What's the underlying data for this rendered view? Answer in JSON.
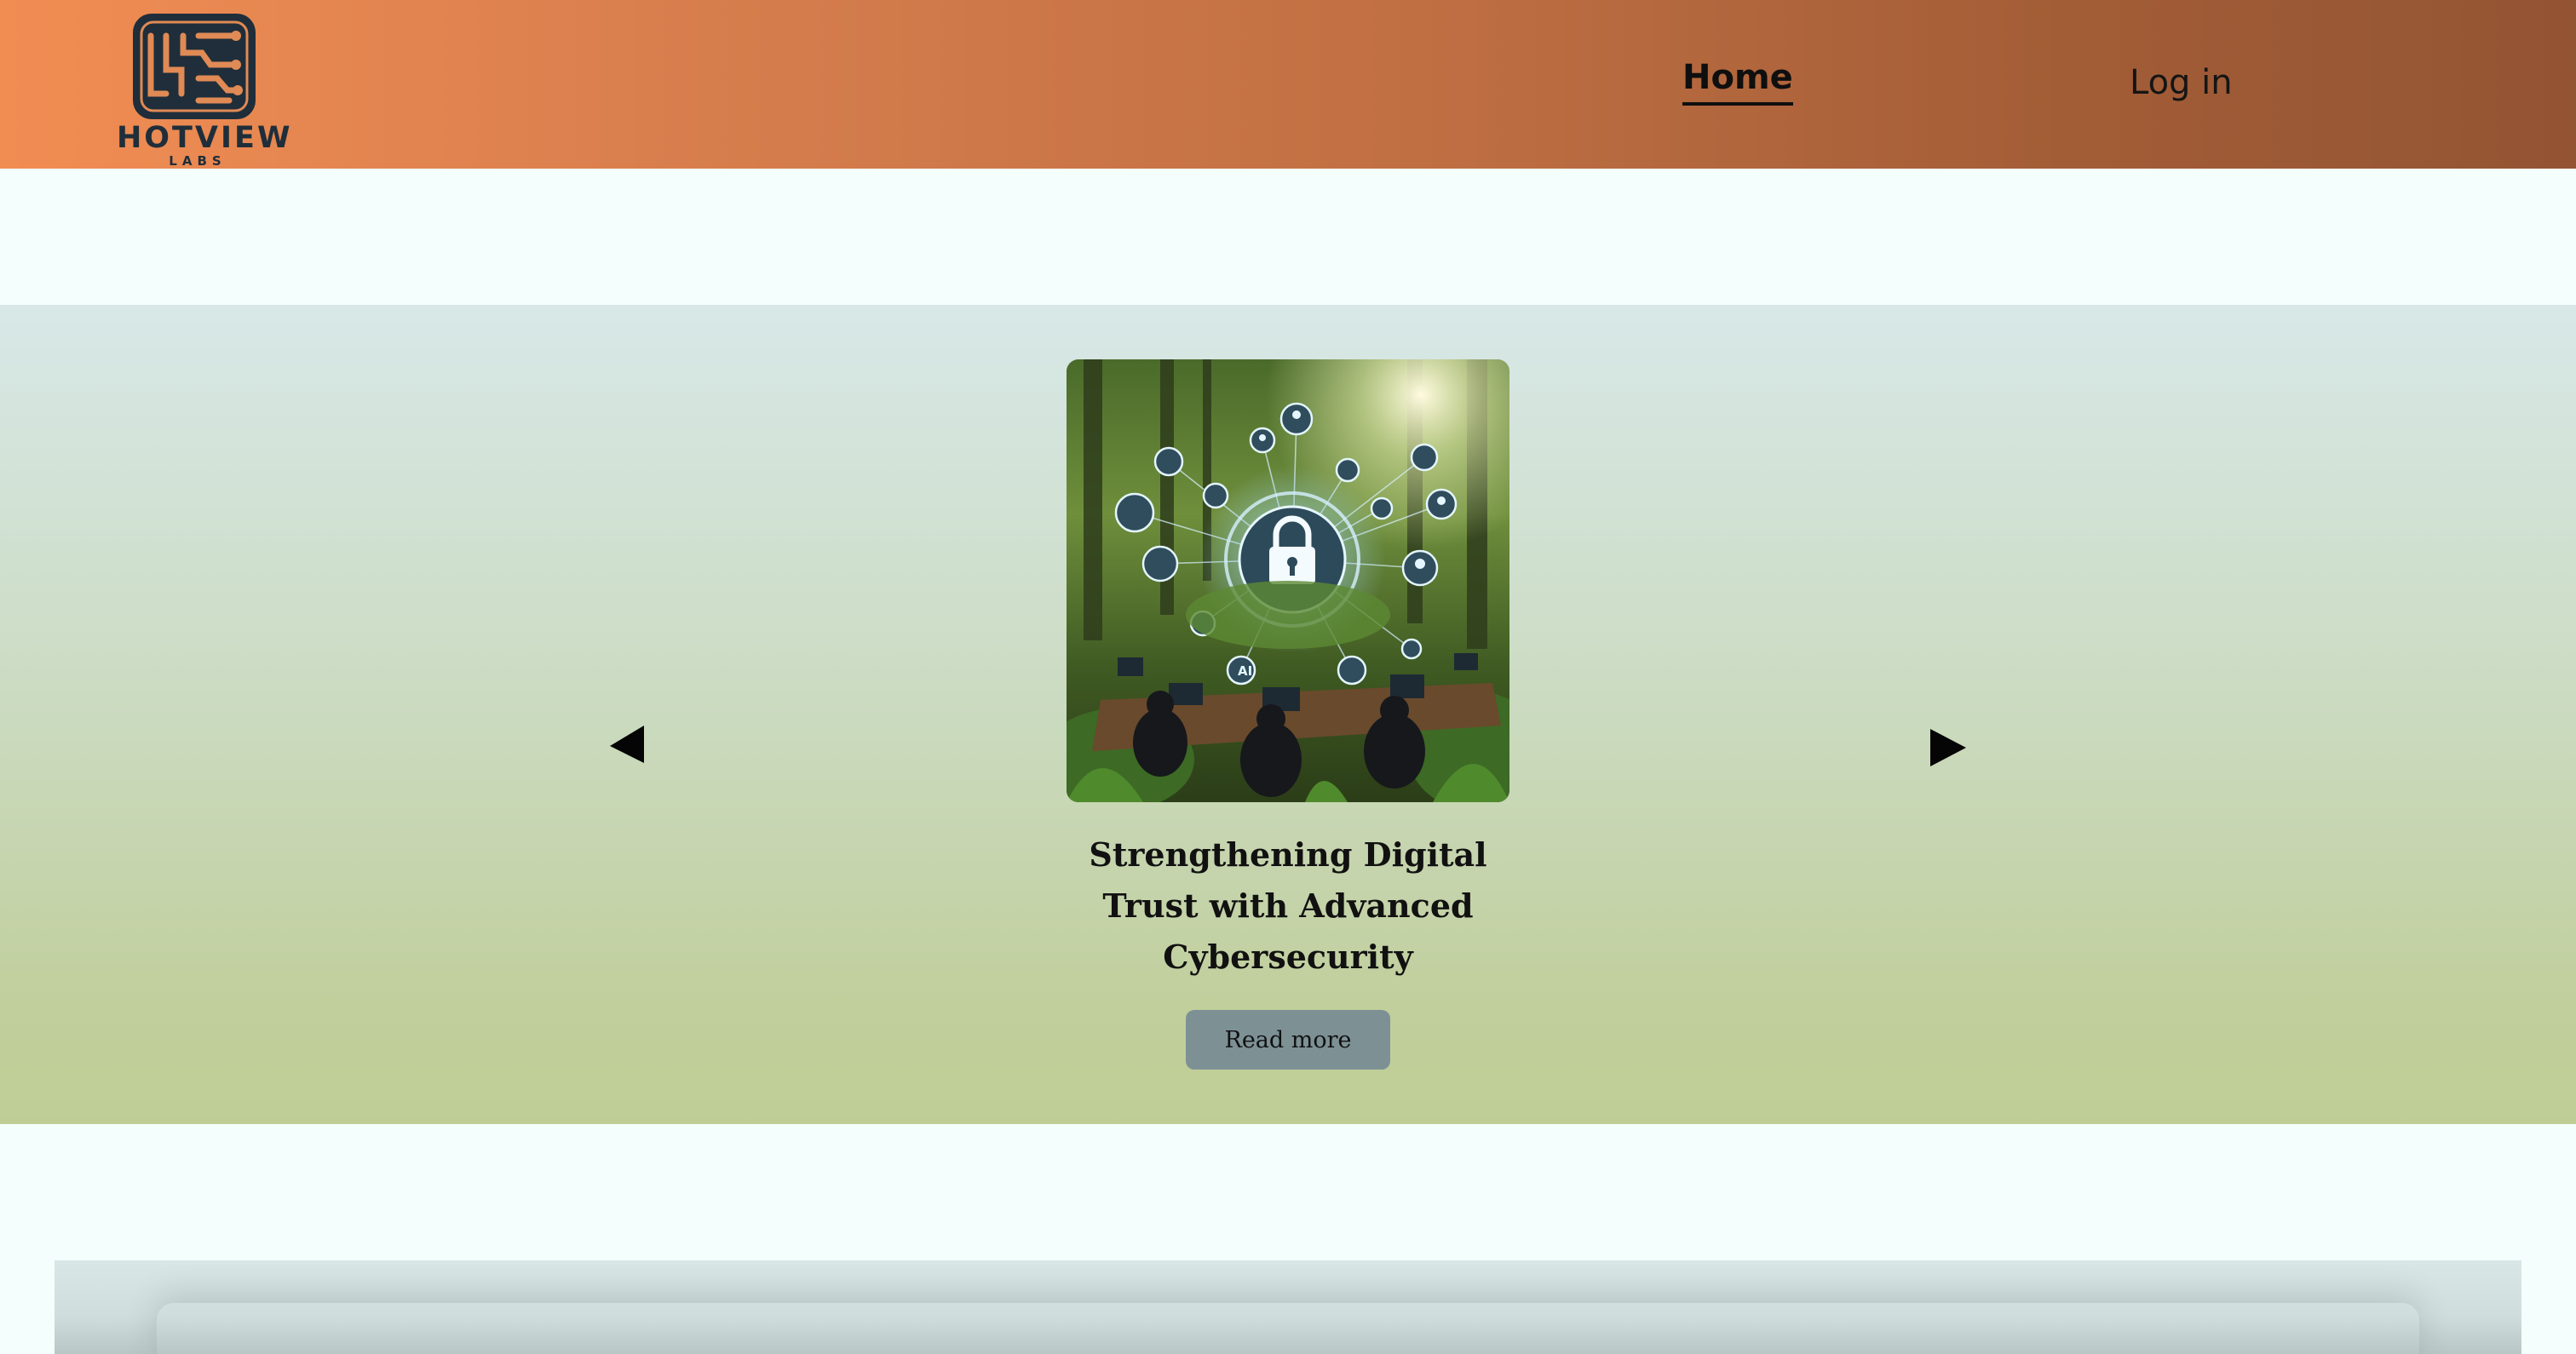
{
  "brand": {
    "name": "HOTVIEW",
    "sub": "LABS",
    "logo_icon": "circuit-board-icon",
    "header_color_start": "#f18d53",
    "header_color_end": "#935434"
  },
  "nav": {
    "home_label": "Home",
    "login_label": "Log in"
  },
  "carousel": {
    "slide_image": "forest-cybersecurity-lock-illustration",
    "slide_title": "Strengthening Digital Trust with Advanced Cybersecurity",
    "read_more_label": "Read more",
    "prev_icon": "triangle-left-icon",
    "next_icon": "triangle-right-icon",
    "image_badge_text": "AI",
    "button_color": "#7d9195"
  }
}
